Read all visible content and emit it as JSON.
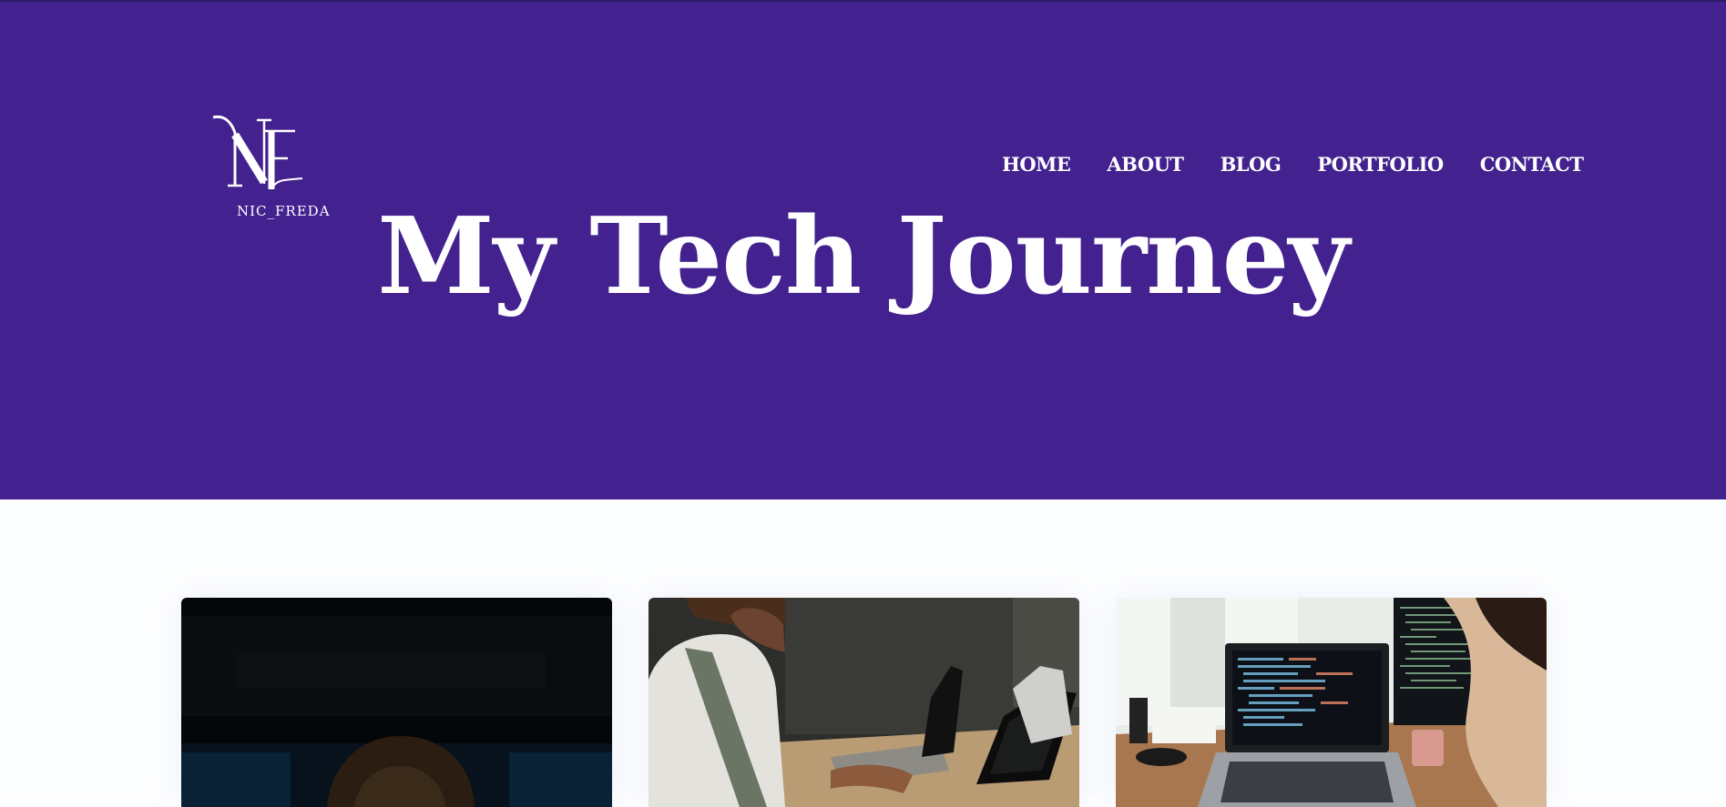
{
  "header": {
    "logo": {
      "monogram": "NF",
      "caption": "NIC_FREDA"
    },
    "nav": [
      {
        "label": "HOME"
      },
      {
        "label": "ABOUT"
      },
      {
        "label": "BLOG"
      },
      {
        "label": "PORTFOLIO"
      },
      {
        "label": "CONTACT"
      }
    ],
    "title": "My Tech Journey"
  },
  "colors": {
    "hero_bg": "#43218f",
    "text": "#ffffff",
    "page_bg": "#ffffff"
  },
  "posts": [
    {
      "image": "dark-laptop-person-photo"
    },
    {
      "image": "woman-typing-laptop-photo"
    },
    {
      "image": "code-monitor-desk-photo"
    }
  ]
}
